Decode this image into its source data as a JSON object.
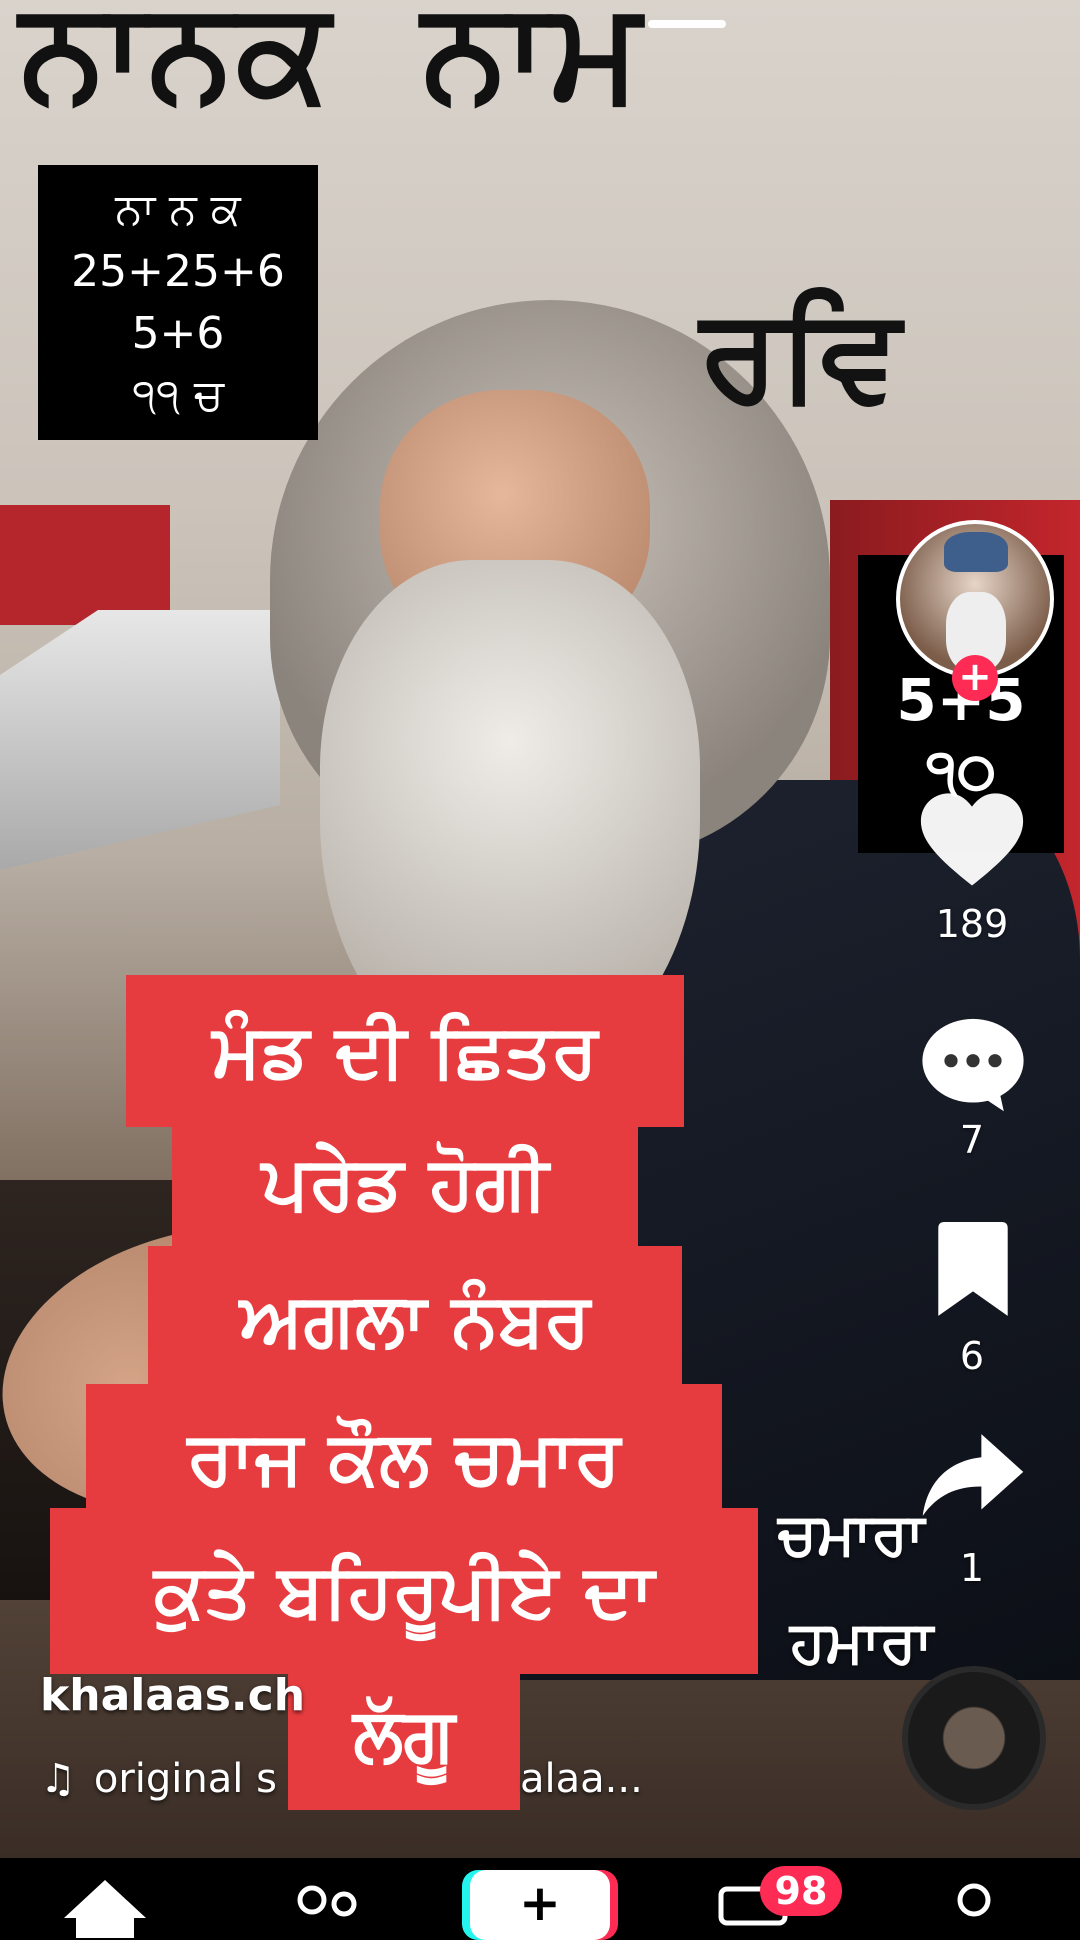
{
  "overlay": {
    "title_left": "ਨਾਨਕ",
    "title_right": "ਨਾਮ",
    "rav": "ਰਵਿ",
    "box_lines": [
      "ਨਾ ਨ ਕ",
      "25+25+6",
      "5+6",
      "੧੧ ਚ"
    ],
    "right_box_lines": [
      "5+5",
      "੧੦"
    ],
    "caption_lines": [
      "ਮੰਡ ਦੀ ਛਿਤਰ",
      "ਪਰੇਡ ਹੋਗੀ",
      "ਅਗਲਾ ਨੰਬਰ",
      "ਰਾਜ ਕੌਲ ਚਮਾਰ",
      "ਕੁਤੇ ਬਹਿਰੂਪੀਏ ਦਾ",
      "ਲੱਗੂ"
    ],
    "bg_words": [
      "ਚਮਾਰਾ",
      "ਹਮਾਰਾ"
    ]
  },
  "actions": {
    "likes": "189",
    "comments": "7",
    "saves": "6",
    "shares": "1"
  },
  "meta": {
    "username": "khalaas.ch",
    "sound_prefix": "original s",
    "sound_suffix": "alaa..."
  },
  "nav": {
    "inbox_badge": "98"
  },
  "colors": {
    "caption_bg": "#e63c3f",
    "accent": "#fe2c55",
    "accent2": "#25f4ee"
  }
}
